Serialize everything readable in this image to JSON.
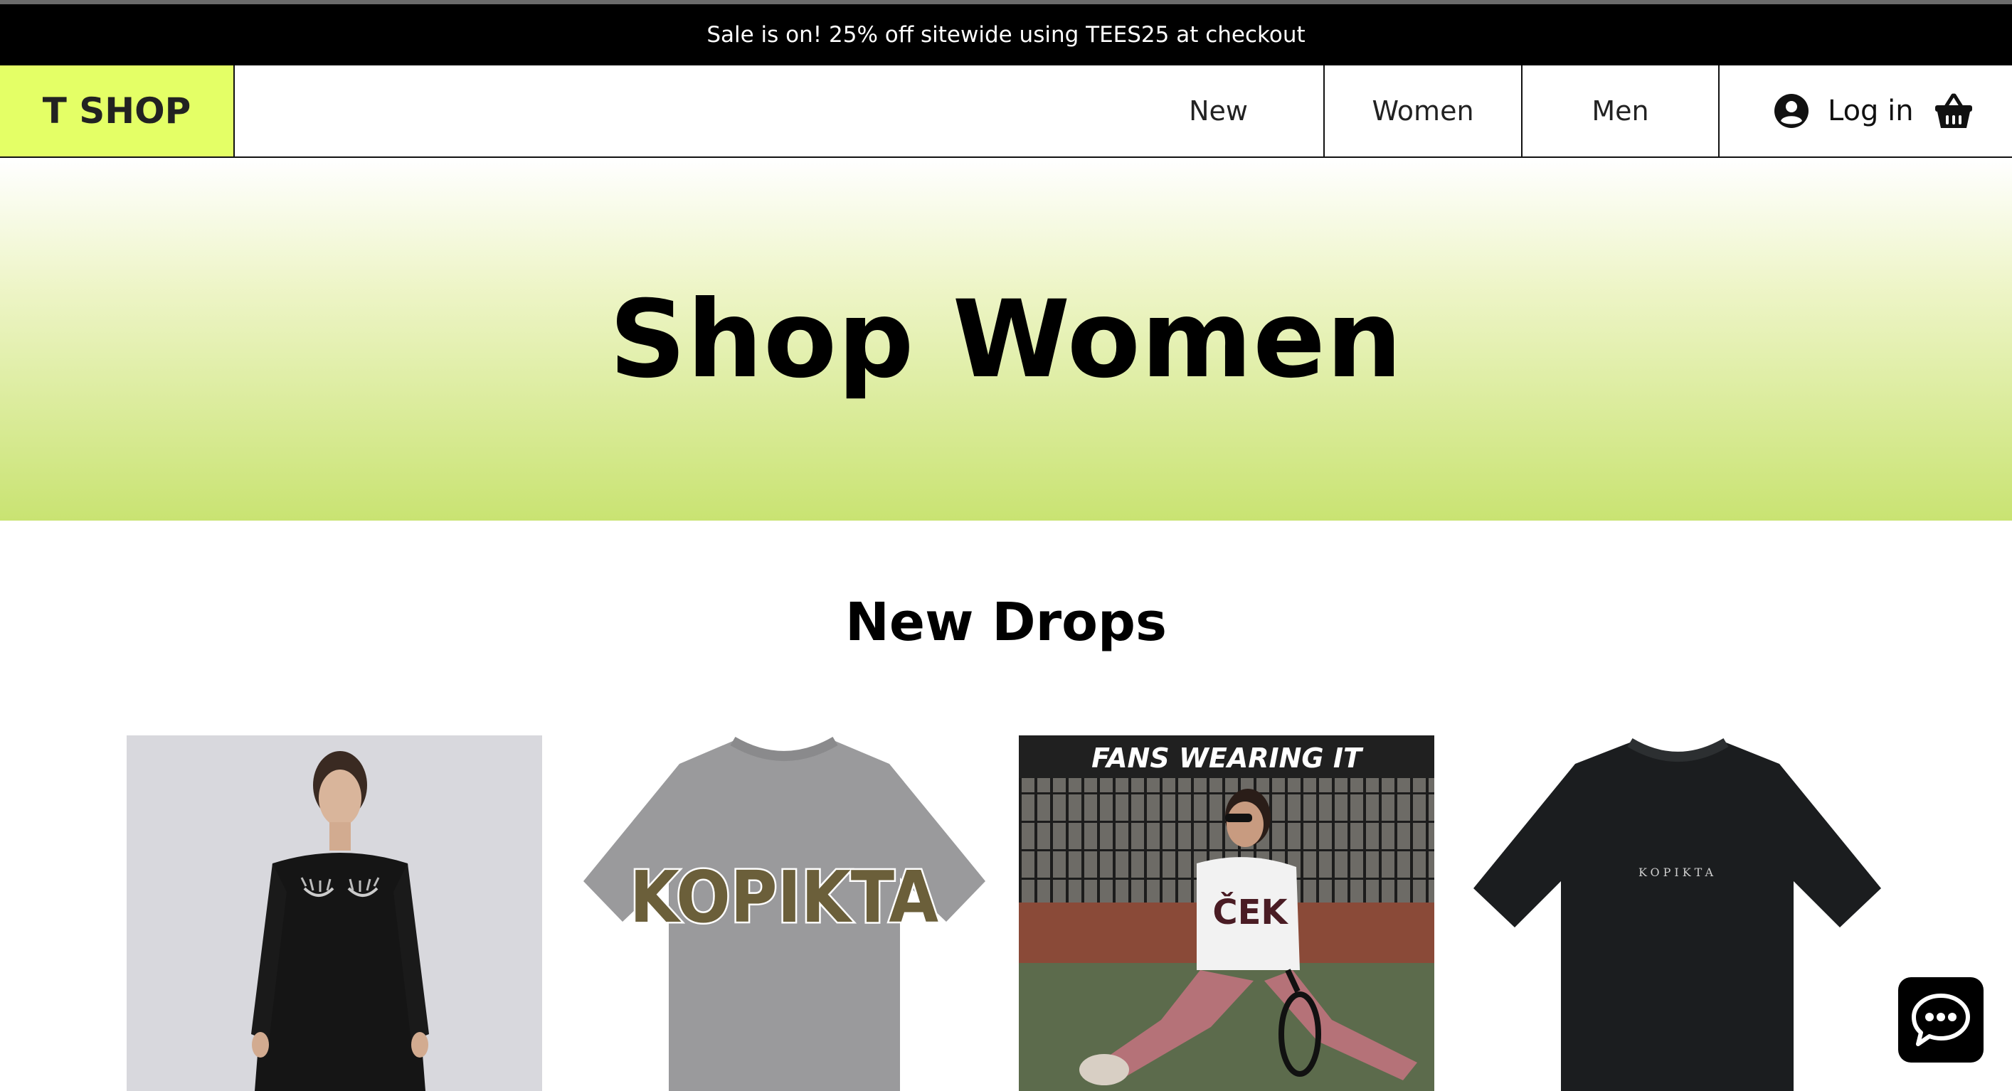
{
  "announcement": {
    "text": "Sale is on! 25% off sitewide using TEES25 at checkout"
  },
  "header": {
    "logo": "T SHOP",
    "nav": [
      {
        "label": "New"
      },
      {
        "label": "Women"
      },
      {
        "label": "Men"
      }
    ],
    "login_label": "Log in",
    "icons": {
      "account": "account-circle-icon",
      "cart": "basket-icon"
    }
  },
  "hero": {
    "title": "Shop Women"
  },
  "section": {
    "title": "New Drops"
  },
  "products": [
    {
      "image": "black-sweatshirt-dress-with-eyelash-print"
    },
    {
      "image": "grey-tshirt-kopikta-print",
      "print_text": "KOPIKTA"
    },
    {
      "image": "fan-photo-tennis-court",
      "overlay_text": "FANS WEARING IT",
      "shirt_text": "ČEK"
    },
    {
      "image": "black-tshirt-kopikta-logo",
      "print_text": "KOPIKTA"
    }
  ],
  "chat": {
    "icon": "chat-bubble-icon"
  },
  "colors": {
    "accent": "#e4ff66",
    "hero_bottom": "#c9e372",
    "announce_bg": "#000000"
  }
}
